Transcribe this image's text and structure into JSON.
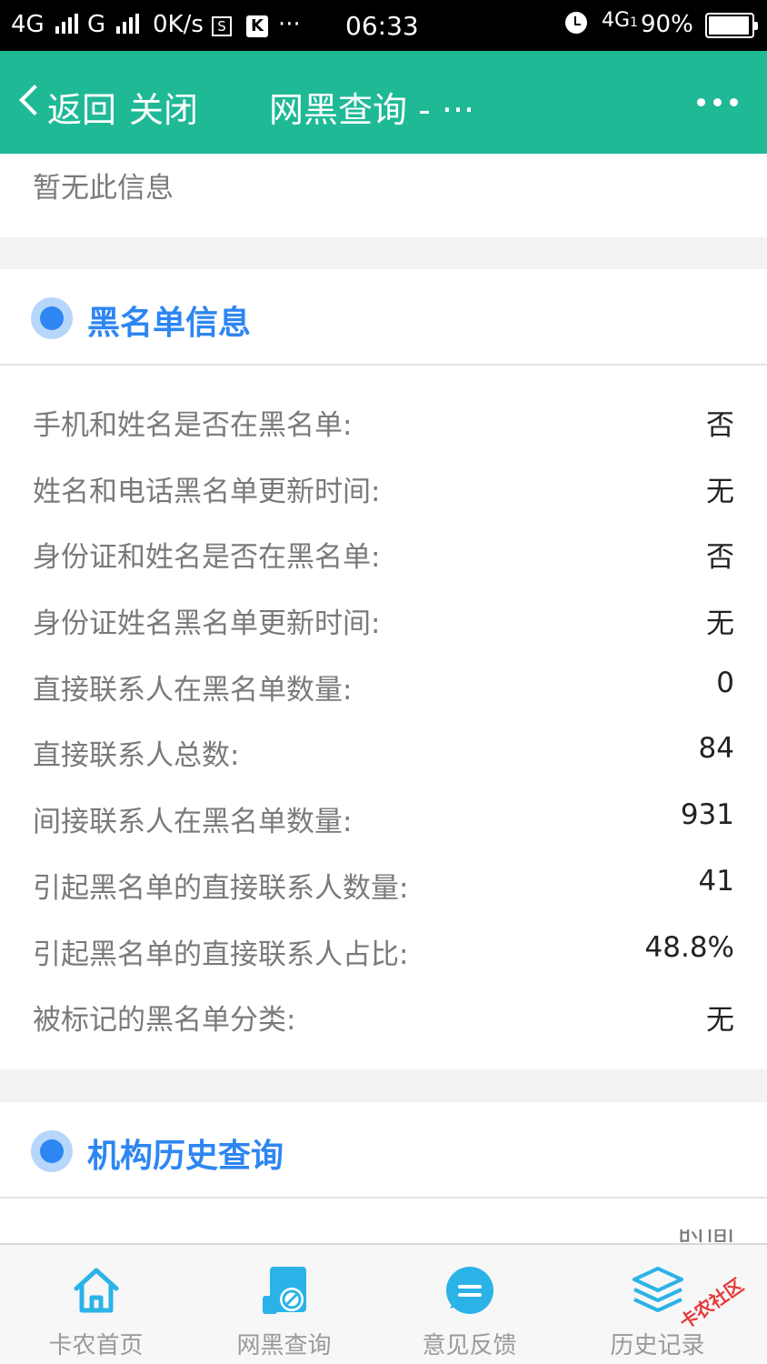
{
  "status_bar": {
    "net1": "4G",
    "net2": "G",
    "speed": "0K/s",
    "s_icon": "S",
    "k_icon": "K",
    "more": "···",
    "time": "06:33",
    "net3": "4G",
    "net3_sub": "1",
    "battery": "90%"
  },
  "nav": {
    "back_label": "返回",
    "close_label": "关闭",
    "title": "网黑查询 - ···"
  },
  "top_card": {
    "text": "暂无此信息"
  },
  "blacklist": {
    "title": "黑名单信息",
    "rows": [
      {
        "label": "手机和姓名是否在黑名单:",
        "value": "否"
      },
      {
        "label": "姓名和电话黑名单更新时间:",
        "value": "无"
      },
      {
        "label": "身份证和姓名是否在黑名单:",
        "value": "否"
      },
      {
        "label": "身份证姓名黑名单更新时间:",
        "value": "无"
      },
      {
        "label": "直接联系人在黑名单数量:",
        "value": "0"
      },
      {
        "label": "直接联系人总数:",
        "value": "84"
      },
      {
        "label": "间接联系人在黑名单数量:",
        "value": "931"
      },
      {
        "label": "引起黑名单的直接联系人数量:",
        "value": "41"
      },
      {
        "label": "引起黑名单的直接联系人占比:",
        "value": "48.8%"
      },
      {
        "label": "被标记的黑名单分类:",
        "value": "无"
      }
    ]
  },
  "history": {
    "title": "机构历史查询",
    "cut_text": "时间"
  },
  "tabs": [
    {
      "label": "卡农首页",
      "icon": "home-icon"
    },
    {
      "label": "网黑查询",
      "icon": "blacklist-query-icon"
    },
    {
      "label": "意见反馈",
      "icon": "feedback-icon"
    },
    {
      "label": "历史记录",
      "icon": "layers-icon"
    }
  ],
  "watermark": "卡农社区",
  "colors": {
    "nav_bg": "#1fb996",
    "accent": "#2d86f2",
    "tab_icon": "#2bb3e8"
  }
}
